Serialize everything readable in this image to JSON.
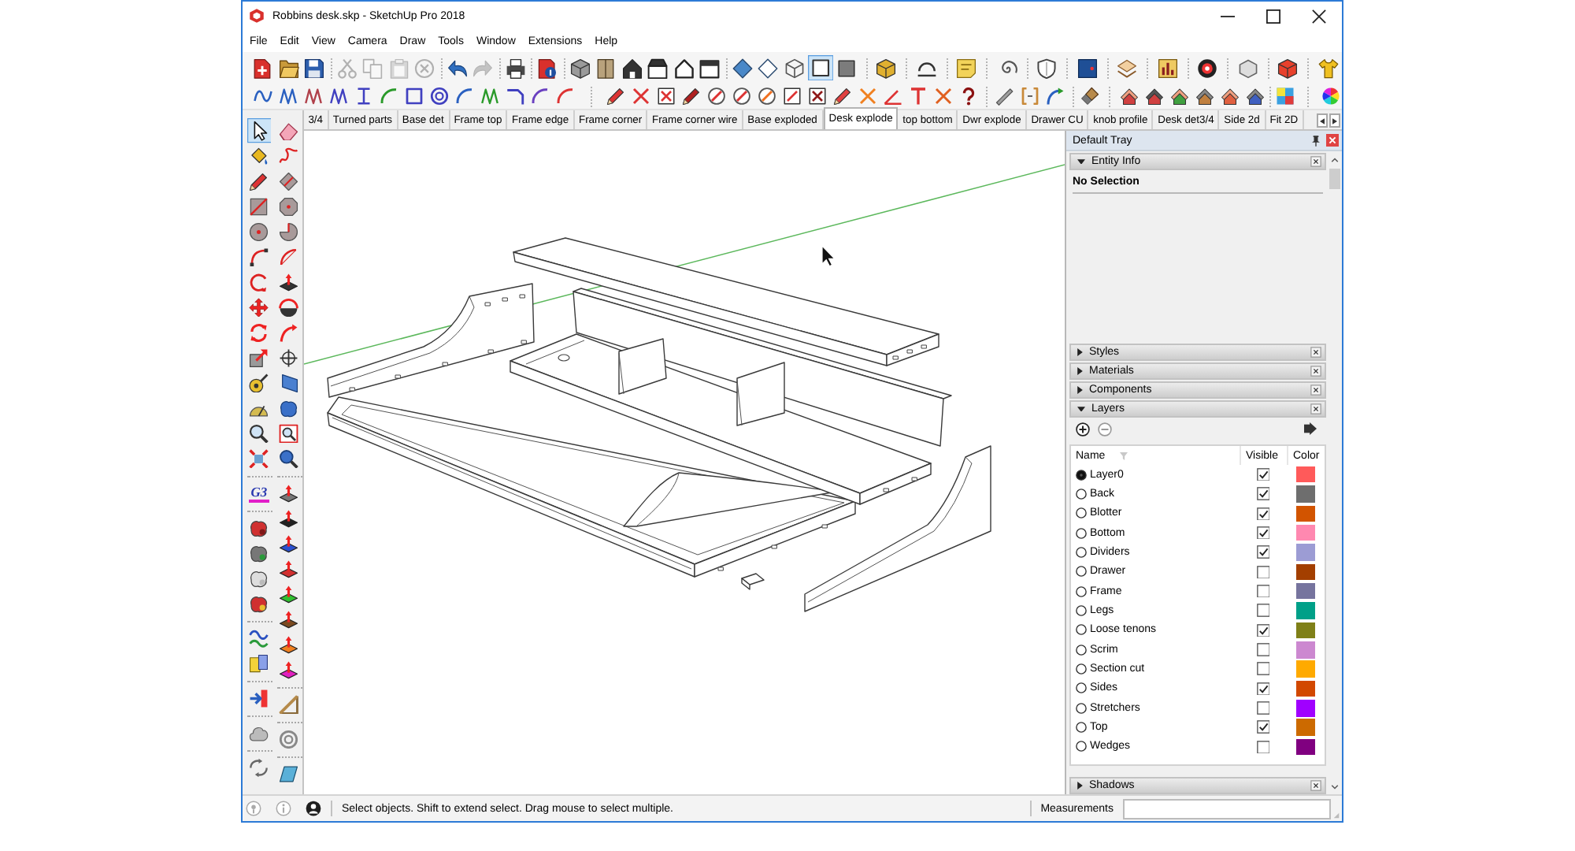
{
  "window": {
    "title": "Robbins desk.skp - SketchUp Pro 2018"
  },
  "menu": [
    "File",
    "Edit",
    "View",
    "Camera",
    "Draw",
    "Tools",
    "Window",
    "Extensions",
    "Help"
  ],
  "standard_toolbar": [
    {
      "disabled": false,
      "selected": false
    },
    {
      "disabled": false,
      "selected": false
    },
    {
      "disabled": false,
      "selected": false
    },
    {
      "disabled": true,
      "selected": false
    },
    {
      "disabled": true,
      "selected": false
    },
    {
      "disabled": true,
      "selected": false
    },
    {
      "disabled": true,
      "selected": false
    },
    {
      "disabled": false,
      "selected": false
    },
    {
      "disabled": true,
      "selected": false
    },
    {
      "disabled": false,
      "selected": false
    },
    {
      "disabled": false,
      "selected": false
    },
    {
      "disabled": false,
      "selected": false
    },
    {
      "disabled": false,
      "selected": false
    },
    {
      "disabled": false,
      "selected": false
    },
    {
      "disabled": false,
      "selected": false
    },
    {
      "disabled": false,
      "selected": false
    },
    {
      "disabled": false,
      "selected": false
    },
    {
      "disabled": false,
      "selected": false
    },
    {
      "disabled": false,
      "selected": false
    },
    {
      "disabled": false,
      "selected": false
    },
    {
      "disabled": false,
      "selected": true
    },
    {
      "disabled": false,
      "selected": false
    },
    {
      "disabled": false,
      "selected": false
    },
    {
      "disabled": false,
      "selected": false
    },
    {
      "disabled": false,
      "selected": false
    },
    {
      "disabled": false,
      "selected": false
    },
    {
      "disabled": false,
      "selected": false
    },
    {
      "disabled": false,
      "selected": false
    },
    {
      "disabled": false,
      "selected": false
    },
    {
      "disabled": false,
      "selected": false
    },
    {
      "disabled": false,
      "selected": false
    },
    {
      "disabled": false,
      "selected": false
    },
    {
      "disabled": false,
      "selected": false
    },
    {
      "disabled": false,
      "selected": false
    }
  ],
  "tool_palette": {
    "column_1": [
      {
        "selected": true
      },
      {
        "selected": false
      },
      {
        "selected": false
      },
      {
        "selected": false
      },
      {
        "selected": false
      },
      {
        "selected": false
      },
      {
        "selected": false
      },
      {
        "selected": false
      },
      {
        "selected": false
      },
      {
        "selected": false
      },
      {
        "selected": false
      },
      {
        "selected": false
      },
      {
        "selected": false
      },
      {
        "selected": false
      },
      {
        "selected": false,
        "label": "G3"
      },
      {
        "selected": false
      },
      {
        "selected": false
      },
      {
        "selected": false
      },
      {
        "selected": false
      },
      {
        "selected": false
      },
      {
        "selected": false
      },
      {
        "selected": false
      },
      {
        "selected": false
      },
      {
        "selected": false
      }
    ],
    "column_2": [
      {
        "selected": false
      },
      {
        "selected": false
      },
      {
        "selected": false
      },
      {
        "selected": false
      },
      {
        "selected": false
      },
      {
        "selected": false
      },
      {
        "selected": false
      },
      {
        "selected": false
      },
      {
        "selected": false
      },
      {
        "selected": false
      },
      {
        "selected": false
      },
      {
        "selected": false
      },
      {
        "selected": false
      },
      {
        "selected": false
      },
      {
        "selected": false
      },
      {
        "selected": false
      },
      {
        "selected": false
      },
      {
        "selected": false
      },
      {
        "selected": false
      },
      {
        "selected": false
      },
      {
        "selected": false
      },
      {
        "selected": false
      },
      {
        "selected": false
      },
      {
        "selected": false
      },
      {
        "selected": false
      }
    ]
  },
  "scene_tabs": [
    {
      "label": "3/4",
      "selected": false
    },
    {
      "label": "Turned parts",
      "selected": false
    },
    {
      "label": "Base det",
      "selected": false
    },
    {
      "label": "Frame top",
      "selected": false
    },
    {
      "label": "Frame edge",
      "selected": false
    },
    {
      "label": "Frame corner",
      "selected": false
    },
    {
      "label": "Frame corner wire",
      "selected": false
    },
    {
      "label": "Base exploded",
      "selected": false
    },
    {
      "label": "Desk explode",
      "selected": true
    },
    {
      "label": "top bottom",
      "selected": false
    },
    {
      "label": "Dwr explode",
      "selected": false
    },
    {
      "label": "Drawer CU",
      "selected": false
    },
    {
      "label": "knob profile",
      "selected": false
    },
    {
      "label": "Desk det3/4",
      "selected": false
    },
    {
      "label": "Side 2d",
      "selected": false
    },
    {
      "label": "Fit 2D",
      "selected": false
    }
  ],
  "tray": {
    "title": "Default Tray",
    "panels": [
      {
        "title": "Entity Info",
        "kind": "entity_info",
        "expanded": true,
        "selection": "No Selection"
      },
      {
        "title": "Styles",
        "expanded": false
      },
      {
        "title": "Materials",
        "expanded": false
      },
      {
        "title": "Components",
        "expanded": false
      },
      {
        "title": "Layers",
        "kind": "layers",
        "expanded": true,
        "columns": [
          "Name",
          "Visible",
          "Color"
        ],
        "rows": [
          {
            "name": "Layer0",
            "selected": true,
            "visible": true,
            "color": "#ff5a5a"
          },
          {
            "name": "Back",
            "selected": false,
            "visible": true,
            "color": "#6e6e6e"
          },
          {
            "name": "Blotter",
            "selected": false,
            "visible": true,
            "color": "#d25400"
          },
          {
            "name": "Bottom",
            "selected": false,
            "visible": true,
            "color": "#ff88b0"
          },
          {
            "name": "Dividers",
            "selected": false,
            "visible": true,
            "color": "#9c9cd4"
          },
          {
            "name": "Drawer",
            "selected": false,
            "visible": false,
            "color": "#a33f00"
          },
          {
            "name": "Frame",
            "selected": false,
            "visible": false,
            "color": "#76749e"
          },
          {
            "name": "Legs",
            "selected": false,
            "visible": false,
            "color": "#00a088"
          },
          {
            "name": "Loose tenons",
            "selected": false,
            "visible": true,
            "color": "#7f8018"
          },
          {
            "name": "Scrim",
            "selected": false,
            "visible": false,
            "color": "#cc88d0"
          },
          {
            "name": "Section cut",
            "selected": false,
            "visible": false,
            "color": "#ffaa00"
          },
          {
            "name": "Sides",
            "selected": false,
            "visible": true,
            "color": "#d24800"
          },
          {
            "name": "Stretchers",
            "selected": false,
            "visible": false,
            "color": "#a000ff"
          },
          {
            "name": "Top",
            "selected": false,
            "visible": true,
            "color": "#cc6a00"
          },
          {
            "name": "Wedges",
            "selected": false,
            "visible": false,
            "color": "#800080"
          }
        ]
      },
      {
        "title": "Shadows",
        "expanded": false
      }
    ]
  },
  "status_bar": {
    "message": "Select objects. Shift to extend select. Drag mouse to select multiple.",
    "measurements_label": "Measurements"
  }
}
